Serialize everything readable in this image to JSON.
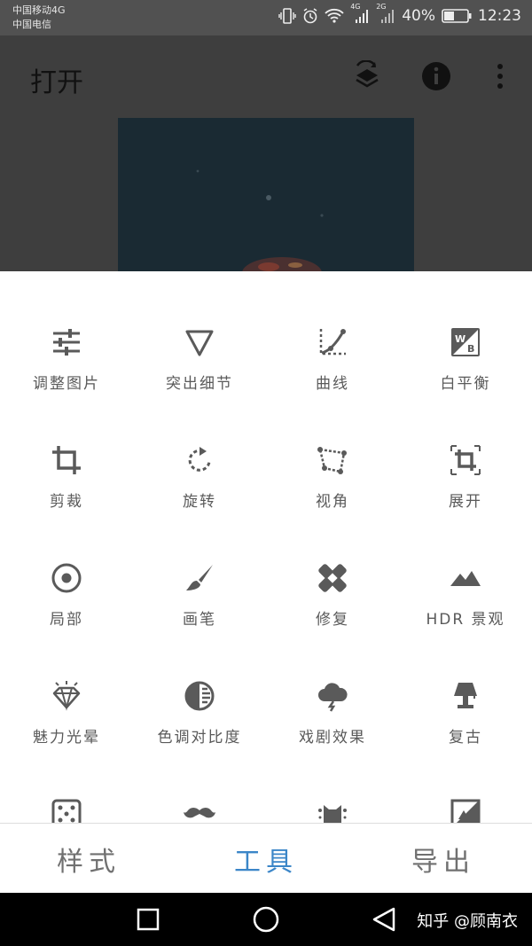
{
  "status_bar": {
    "carrier_1": "中国移动4G",
    "carrier_2": "中国电信",
    "signal_1_label": "4G",
    "signal_2_label": "2G",
    "battery": "40%",
    "time": "12:23"
  },
  "app_bar": {
    "title": "打开",
    "icons": [
      "layers-revert-icon",
      "info-icon",
      "more-vert-icon"
    ]
  },
  "tools": [
    {
      "label": "调整图片",
      "icon": "tune-icon"
    },
    {
      "label": "突出细节",
      "icon": "details-triangle-icon"
    },
    {
      "label": "曲线",
      "icon": "curves-icon"
    },
    {
      "label": "白平衡",
      "icon": "white-balance-icon"
    },
    {
      "label": "剪裁",
      "icon": "crop-icon"
    },
    {
      "label": "旋转",
      "icon": "rotate-icon"
    },
    {
      "label": "视角",
      "icon": "perspective-icon"
    },
    {
      "label": "展开",
      "icon": "expand-icon"
    },
    {
      "label": "局部",
      "icon": "selective-icon"
    },
    {
      "label": "画笔",
      "icon": "brush-icon"
    },
    {
      "label": "修复",
      "icon": "healing-icon"
    },
    {
      "label": "HDR 景观",
      "icon": "hdr-mountain-icon"
    },
    {
      "label": "魅力光晕",
      "icon": "glamour-glow-icon"
    },
    {
      "label": "色调对比度",
      "icon": "tonal-contrast-icon"
    },
    {
      "label": "戏剧效果",
      "icon": "drama-cloud-icon"
    },
    {
      "label": "复古",
      "icon": "vintage-lamp-icon"
    },
    {
      "label": "",
      "icon": "grainy-film-icon"
    },
    {
      "label": "",
      "icon": "mustache-icon"
    },
    {
      "label": "",
      "icon": "grunge-icon"
    },
    {
      "label": "",
      "icon": "black-white-icon"
    }
  ],
  "tabs": [
    {
      "label": "样式",
      "active": false
    },
    {
      "label": "工具",
      "active": true
    },
    {
      "label": "导出",
      "active": false
    }
  ],
  "colors": {
    "accent": "#3b86c8",
    "icon": "#5a5a5a"
  },
  "nav_bar": {
    "watermark": "知乎 @顾南衣",
    "buttons": [
      "recent-apps-icon",
      "home-icon",
      "back-icon"
    ]
  }
}
